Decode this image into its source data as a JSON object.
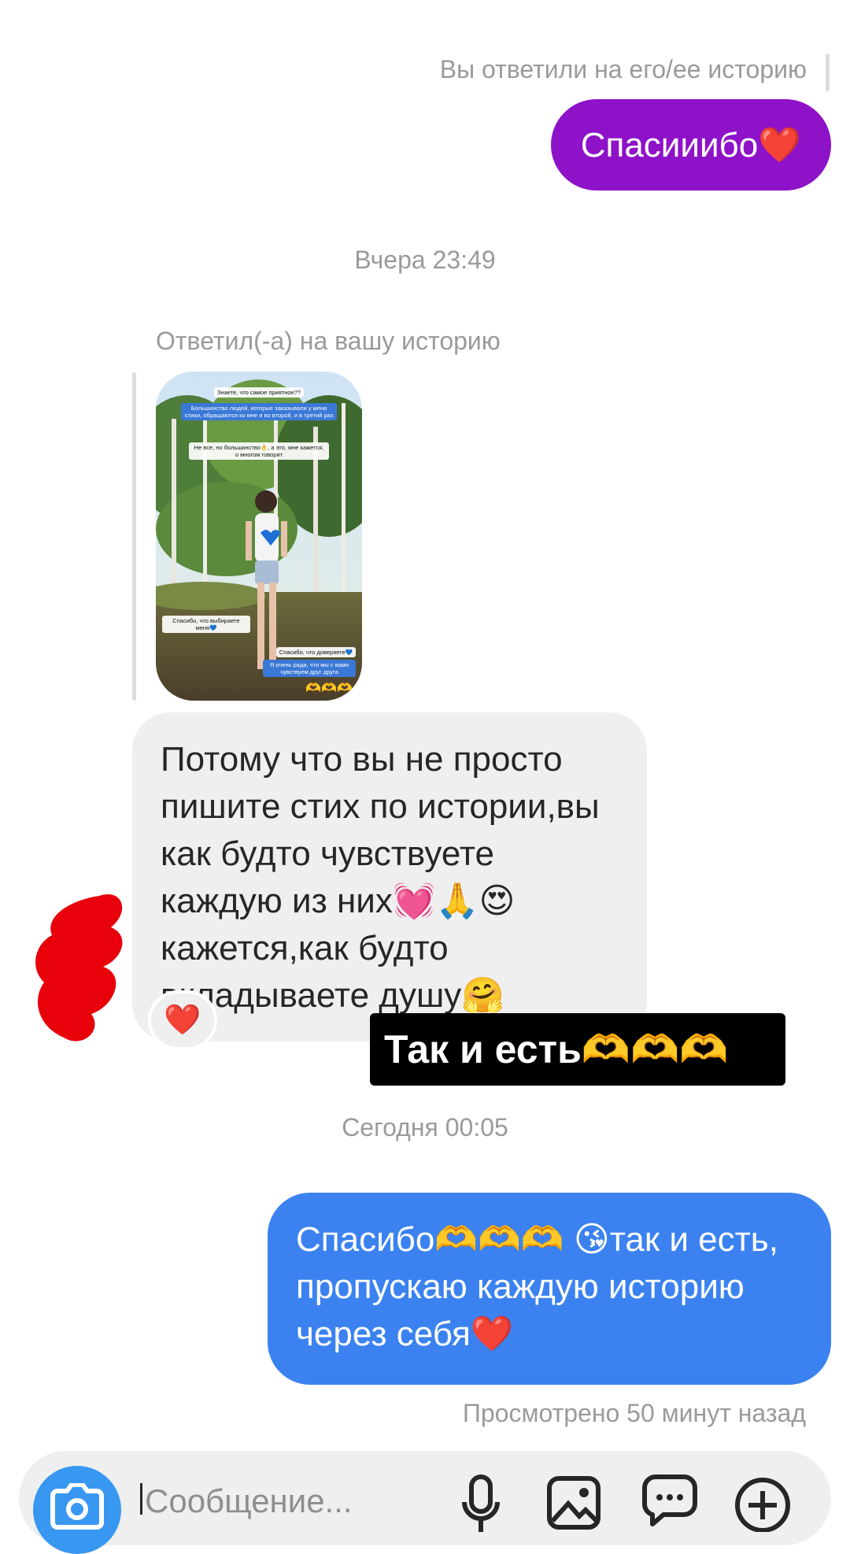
{
  "thread": {
    "reply_note_top": "Вы ответили на его/ее историю",
    "outgoing_thanks": "Спасииибо❤️",
    "timestamp_yesterday": "Вчера 23:49",
    "reply_note_left": "Ответил(-а) на вашу историю",
    "story": {
      "captions": [
        "Знаете, что самое приятное??",
        "Большинство людей, которые заказывали у меня стихи, обращаются ко мне и во второй, и в третий раз",
        "Не все, но большинство👌, а это, мне кажется, о многом говорит",
        "Спасибо, что выбираете меня💙",
        "Спасибо, что доверяете💙",
        "Я очень рада, что мы с вами чувствуем друг друга",
        "🫶🫶🫶"
      ]
    },
    "incoming_long": "Потому что вы не просто пишите стих по истории,вы как будто чувствуете каждую из них💓🙏😍кажется,как будто вкладываете душу🤗",
    "reaction": "❤️",
    "sticker_text": "Так и есть🫶🫶🫶",
    "timestamp_today": "Сегодня 00:05",
    "outgoing_blue": "Спасибо🫶🫶🫶 😘так и есть, пропускаю каждую историю через себя❤️",
    "seen_status": "Просмотрено 50 минут назад"
  },
  "composer": {
    "placeholder": "Сообщение..."
  },
  "colors": {
    "purple_bubble": "#8e12c8",
    "blue_bubble": "#3b82f0",
    "gray_bubble": "#efefef",
    "camera_button": "#3897f0",
    "redaction": "#e8000b"
  },
  "icons": [
    "camera-icon",
    "microphone-icon",
    "gallery-icon",
    "sticker-icon",
    "plus-icon",
    "heart-icon"
  ]
}
